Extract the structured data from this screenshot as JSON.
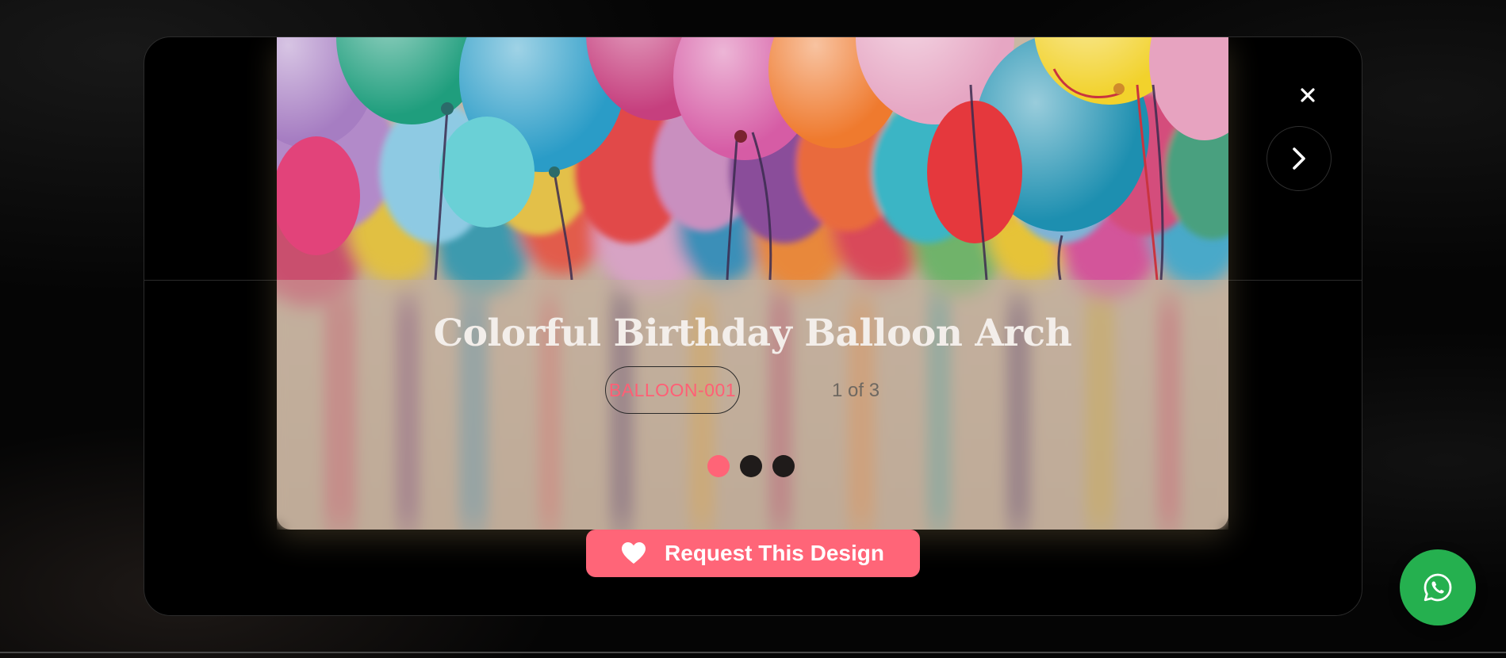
{
  "modal": {
    "title": "Colorful Birthday Balloon Arch",
    "code": "BALLOON-001",
    "counter": "1 of 3",
    "slides": {
      "total": 3,
      "active_index": 0
    },
    "request_button_label": "Request This Design"
  },
  "icons": {
    "close": "close-icon",
    "next": "chevron-right-icon",
    "request": "heart-icon",
    "whatsapp": "whatsapp-icon"
  },
  "colors": {
    "accent": "#ff6578",
    "whatsapp": "#25b04f",
    "modal_bg": "#000000"
  }
}
